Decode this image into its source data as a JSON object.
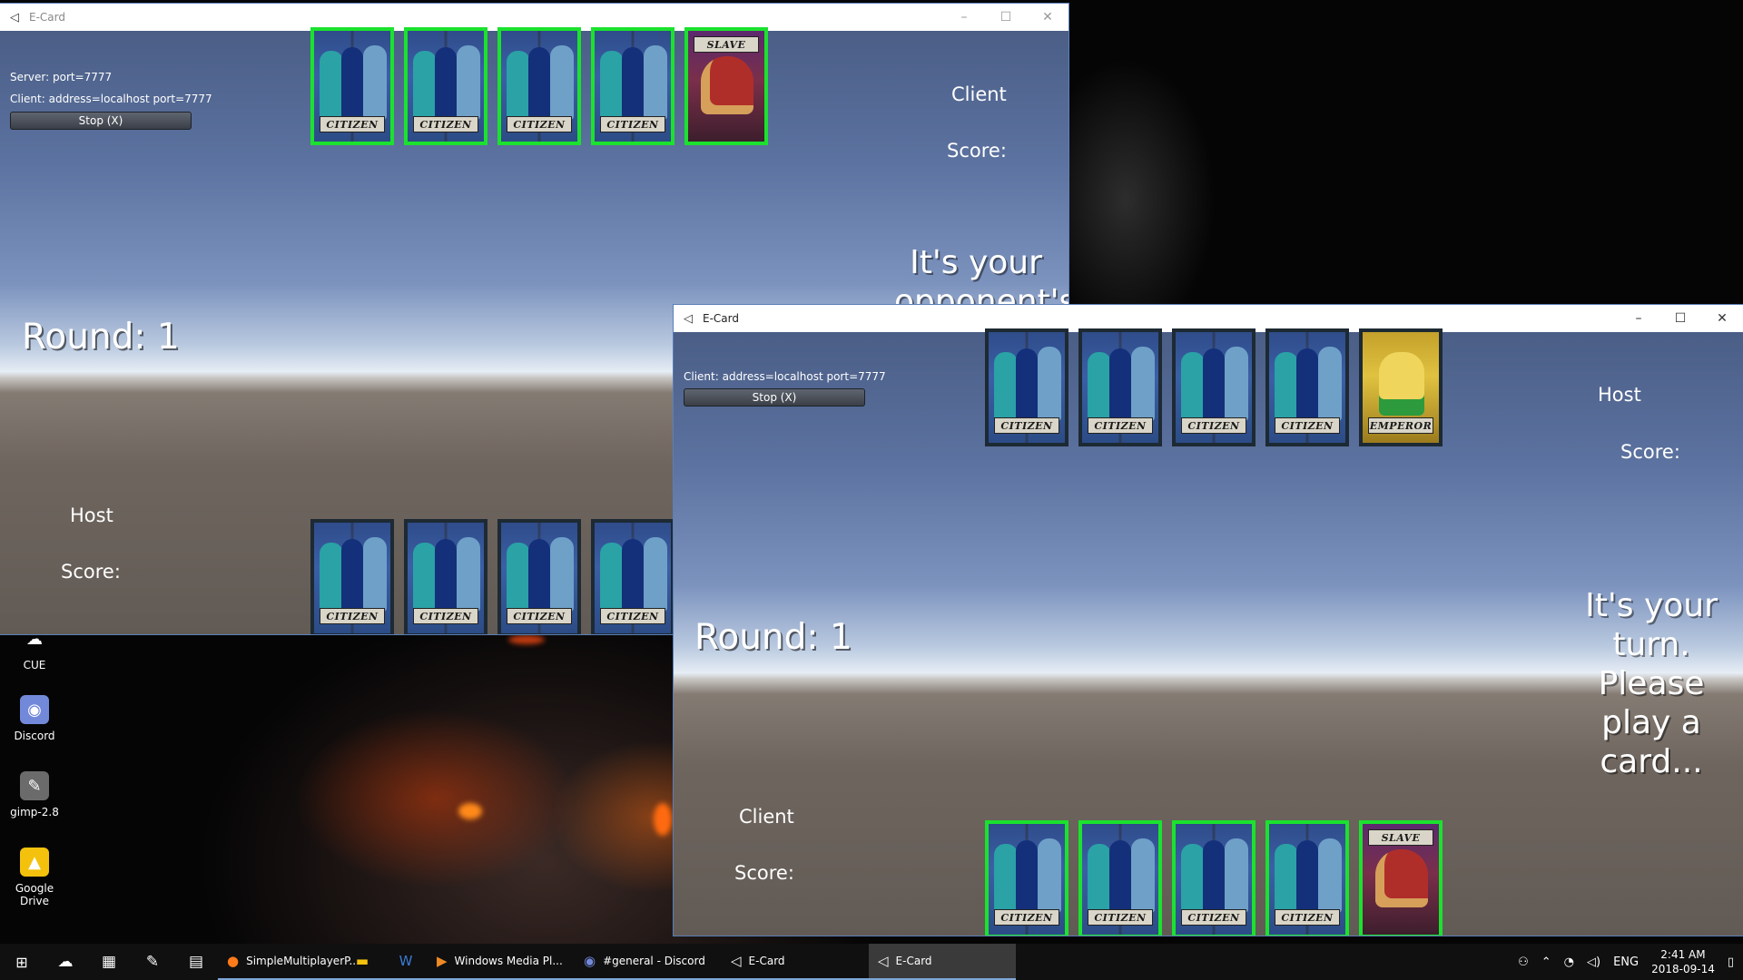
{
  "desktop": {
    "icons": [
      {
        "label": "CUE",
        "icon": "cue-icon"
      },
      {
        "label": "Discord",
        "icon": "discord-icon"
      },
      {
        "label": "gimp-2.8",
        "icon": "gimp-icon"
      },
      {
        "label": "Google Drive",
        "icon": "google-drive-icon"
      }
    ]
  },
  "window_left": {
    "title": "E-Card",
    "server_label": "Server: port=7777",
    "client_label": "Client: address=localhost port=7777",
    "stop_label": "Stop (X)",
    "top_player": "Client",
    "top_score": "Score:",
    "turn_message": "It's your opponent's",
    "round": "Round: 1",
    "bottom_player": "Host",
    "bottom_score": "Score:",
    "top_hand": [
      "CITIZEN",
      "CITIZEN",
      "CITIZEN",
      "CITIZEN",
      "SLAVE"
    ],
    "bottom_hand": [
      "CITIZEN",
      "CITIZEN",
      "CITIZEN",
      "CITIZEN"
    ]
  },
  "window_right": {
    "title": "E-Card",
    "client_label": "Client: address=localhost port=7777",
    "stop_label": "Stop (X)",
    "top_player": "Host",
    "top_score": "Score:",
    "turn_message": "It's your turn. Please play a card...",
    "round": "Round: 1",
    "bottom_player": "Client",
    "bottom_score": "Score:",
    "top_hand": [
      "CITIZEN",
      "CITIZEN",
      "CITIZEN",
      "CITIZEN",
      "EMPEROR"
    ],
    "bottom_hand": [
      "CITIZEN",
      "CITIZEN",
      "CITIZEN",
      "CITIZEN",
      "SLAVE"
    ]
  },
  "window_controls": {
    "minimize": "–",
    "maximize": "☐",
    "close": "✕"
  },
  "taskbar": {
    "pinned": [
      {
        "name": "cue-icon"
      },
      {
        "name": "calculator-icon"
      },
      {
        "name": "paint-icon"
      },
      {
        "name": "notepad-icon"
      }
    ],
    "apps": [
      {
        "label": "SimpleMultiplayerP...",
        "icon": "firefox-icon"
      },
      {
        "label": "",
        "icon": "file-explorer-icon"
      },
      {
        "label": "",
        "icon": "word-icon"
      },
      {
        "label": "Windows Media Pl...",
        "icon": "media-player-icon"
      },
      {
        "label": "#general - Discord",
        "icon": "discord-icon"
      },
      {
        "label": "E-Card",
        "icon": "unity-icon"
      },
      {
        "label": "E-Card",
        "icon": "unity-icon"
      }
    ],
    "tray": {
      "language": "ENG",
      "time": "2:41 AM",
      "date": "2018-09-14"
    }
  },
  "colors": {
    "selectable_border": "#1be22e",
    "default_border": "#1d2a33",
    "taskbar": "#101010"
  }
}
